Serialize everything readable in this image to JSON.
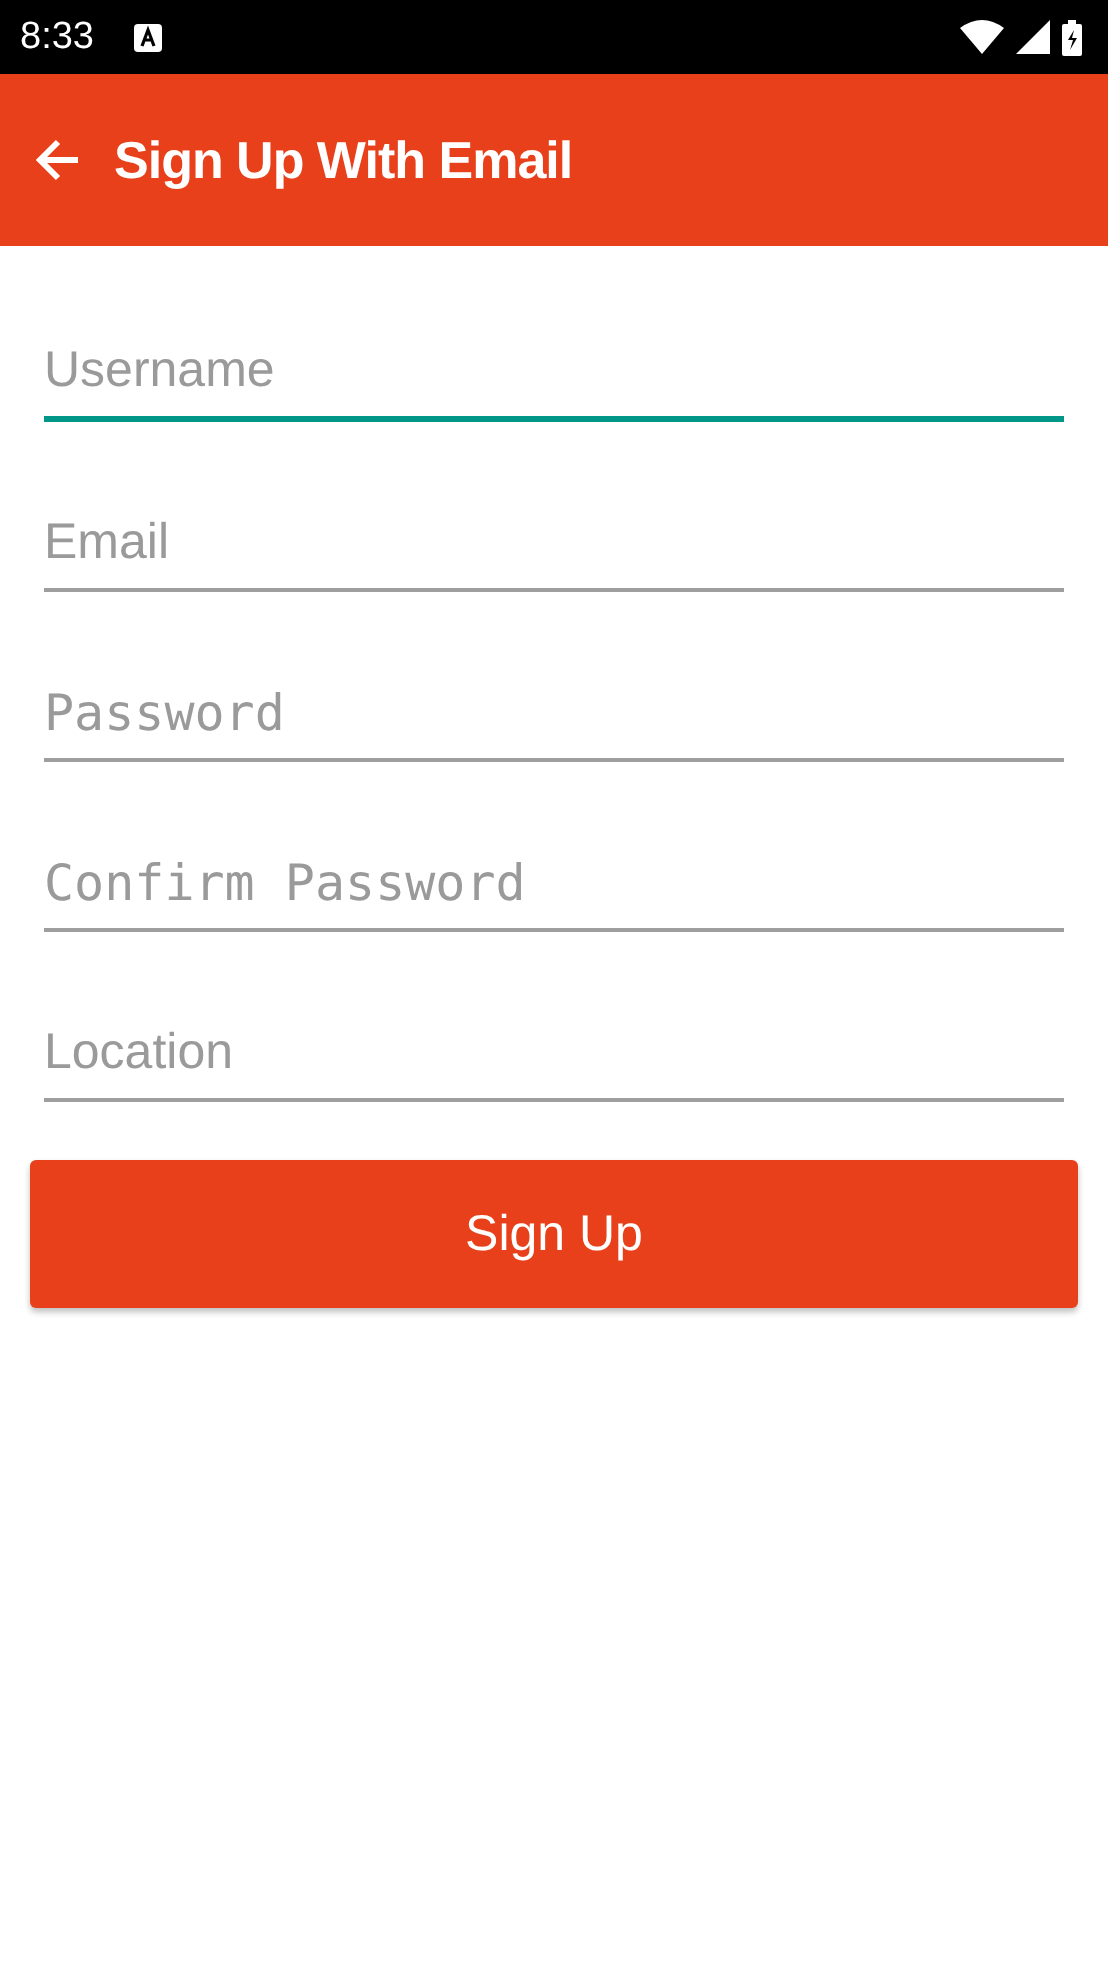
{
  "status_bar": {
    "time": "8:33"
  },
  "app_bar": {
    "title": "Sign Up With Email"
  },
  "fields": [
    {
      "placeholder": "Username",
      "kind": "text",
      "focused": true
    },
    {
      "placeholder": "Email",
      "kind": "text",
      "focused": false
    },
    {
      "placeholder": "Password",
      "kind": "password",
      "focused": false
    },
    {
      "placeholder": "Confirm Password",
      "kind": "password",
      "focused": false
    },
    {
      "placeholder": "Location",
      "kind": "text",
      "focused": false
    }
  ],
  "button": {
    "label": "Sign Up"
  }
}
